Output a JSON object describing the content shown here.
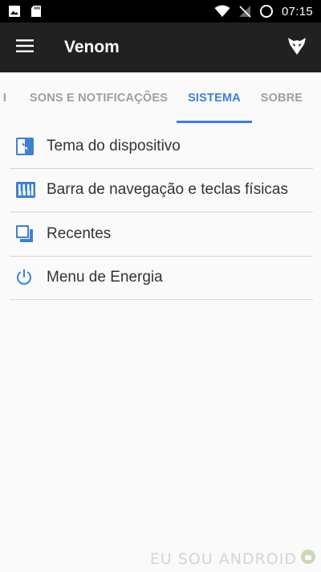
{
  "status_bar": {
    "left_icons": [
      "image-icon",
      "sd-card-icon"
    ],
    "right_icons": [
      "wifi-icon",
      "no-sim-icon",
      "data-saver-icon"
    ],
    "time": "07:15"
  },
  "app_bar": {
    "title": "Venom",
    "menu_icon": "hamburger-menu-icon",
    "logo_icon": "venom-logo-icon"
  },
  "tabs": [
    {
      "label": "I",
      "active": false
    },
    {
      "label": "SONS E NOTIFICAÇÕES",
      "active": false
    },
    {
      "label": "SISTEMA",
      "active": true
    },
    {
      "label": "SOBRE",
      "active": false
    }
  ],
  "list": [
    {
      "label": "Tema do dispositivo",
      "icon": "theme-icon"
    },
    {
      "label": "Barra de navegação e teclas físicas",
      "icon": "keyboard-icon"
    },
    {
      "label": "Recentes",
      "icon": "recents-icon"
    },
    {
      "label": "Menu de Energia",
      "icon": "power-icon"
    }
  ],
  "watermark": "EU SOU ANDROID",
  "colors": {
    "accent": "#3f7fd3",
    "app_bar": "#212121",
    "status_bar": "#000000",
    "background": "#fafafa"
  }
}
